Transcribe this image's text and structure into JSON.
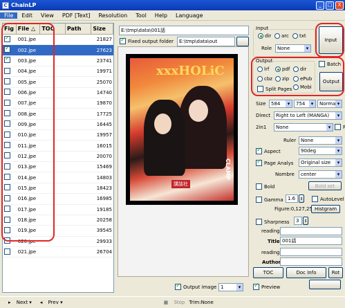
{
  "window": {
    "title": "ChainLP",
    "min": "_",
    "max": "□",
    "close": "X"
  },
  "menu": [
    "File",
    "Edit",
    "View",
    "PDF [Text]",
    "Resolution",
    "Tool",
    "Help",
    "Language"
  ],
  "list": {
    "headers": [
      "Fig",
      "File",
      "TOC",
      "Path",
      "Size"
    ],
    "sort_glyph": "△",
    "rows": [
      {
        "checked": true,
        "file": "001.jpe",
        "size": "21827",
        "sel": false
      },
      {
        "checked": true,
        "file": "002.jpe",
        "size": "27623",
        "sel": true
      },
      {
        "checked": true,
        "file": "003.jpe",
        "size": "23741",
        "sel": false
      },
      {
        "checked": false,
        "file": "004.jpe",
        "size": "19971",
        "sel": false
      },
      {
        "checked": false,
        "file": "005.jpe",
        "size": "25070",
        "sel": false
      },
      {
        "checked": false,
        "file": "006.jpe",
        "size": "14740",
        "sel": false
      },
      {
        "checked": false,
        "file": "007.jpe",
        "size": "19870",
        "sel": false
      },
      {
        "checked": false,
        "file": "008.jpe",
        "size": "17725",
        "sel": false
      },
      {
        "checked": false,
        "file": "009.jpe",
        "size": "16445",
        "sel": false
      },
      {
        "checked": false,
        "file": "010.jpe",
        "size": "19957",
        "sel": false
      },
      {
        "checked": false,
        "file": "011.jpe",
        "size": "16015",
        "sel": false
      },
      {
        "checked": false,
        "file": "012.jpe",
        "size": "20070",
        "sel": false
      },
      {
        "checked": false,
        "file": "013.jpe",
        "size": "15469",
        "sel": false
      },
      {
        "checked": false,
        "file": "014.jpe",
        "size": "14803",
        "sel": false
      },
      {
        "checked": false,
        "file": "015.jpe",
        "size": "18423",
        "sel": false
      },
      {
        "checked": false,
        "file": "016.jpe",
        "size": "16985",
        "sel": false
      },
      {
        "checked": false,
        "file": "017.jpe",
        "size": "19185",
        "sel": false
      },
      {
        "checked": false,
        "file": "018.jpe",
        "size": "20258",
        "sel": false
      },
      {
        "checked": false,
        "file": "019.jpe",
        "size": "39545",
        "sel": false
      },
      {
        "checked": false,
        "file": "020.jpe",
        "size": "29933",
        "sel": false
      },
      {
        "checked": false,
        "file": "021.jpe",
        "size": "26704",
        "sel": false
      }
    ]
  },
  "paths": {
    "source": "E:\\tmp\\data\\001話",
    "fixed_label": "Fixed output folder",
    "output": "E:\\tmp\\data\\out"
  },
  "input": {
    "legend": "Input",
    "options": [
      "dir",
      "arc",
      "txt"
    ],
    "role_label": "Role",
    "role_value": "None",
    "button": "Input"
  },
  "output": {
    "legend": "Output",
    "row1": [
      "lrf",
      "pdf",
      "dir"
    ],
    "row2": [
      "cbz",
      "zip",
      "ePub"
    ],
    "split_label": "Split Pages",
    "mobi": "Mobi",
    "batch": "Batch",
    "button": "Output"
  },
  "settings": {
    "size_label": "Size",
    "size_w": "584",
    "size_h": "754",
    "size_mode": "Normal",
    "direct_label": "Direct",
    "direct_value": "Right to Left (MANGA)",
    "twoin1_label": "2in1",
    "twoin1_value": "None",
    "twoin1_extra": "F",
    "ruler_label": "Ruler",
    "ruler_value": "None",
    "aspect_label": "Aspect",
    "aspect_value": "90deg",
    "page_label": "Page Analys",
    "page_value": "Original size",
    "nombre_label": "Nombre",
    "nombre_value": "center",
    "bold_label": "Bold",
    "boldset_button": "Bold set",
    "gamma_label": "Gamma",
    "gamma_value": "1.6",
    "autolevel_label": "AutoLevel",
    "figure_text": "Figure:0,127,255",
    "histgram_button": "Histgram",
    "sharp_label": "Sharpness",
    "sharp_value": "3",
    "reading1_label": "reading",
    "title_label": "Title",
    "title_value": "001話",
    "reading2_label": "reading",
    "author_label": "Author",
    "toc_button": "TOC",
    "docinfo_button": "Doc Info",
    "rot_button": "Rot",
    "preview_label": "Preview"
  },
  "preview": {
    "output_image_label": "Output image",
    "output_image_value": "1",
    "cover_title": "xxxHOLiC",
    "cover_brand": "CLAMP",
    "cover_badge": "講談社"
  },
  "status": {
    "next": "Next",
    "prev": "Prev",
    "stop": "Stop",
    "trim": "Trim:None"
  }
}
